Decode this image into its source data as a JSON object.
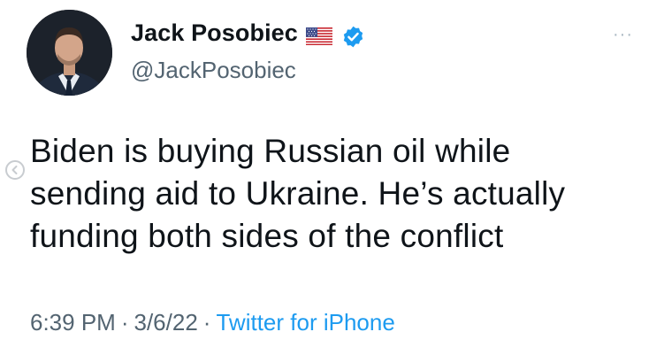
{
  "author": {
    "name": "Jack Posobiec",
    "handle": "@JackPosobiec",
    "flag_icon": "us-flag-icon",
    "verified_icon": "verified-badge-icon",
    "avatar_icon": "profile-photo"
  },
  "more_label": "···",
  "tweet": {
    "lines": [
      "Biden is buying Russian oil while",
      "sending aid to Ukraine. He’s actually",
      "funding both sides of the conflict"
    ]
  },
  "meta": {
    "time": "6:39 PM",
    "separator": "·",
    "date": "3/6/22",
    "source": "Twitter for iPhone"
  },
  "colors": {
    "text": "#0f1419",
    "secondary": "#536471",
    "link": "#1d9bf0",
    "verified": "#1d9bf0"
  }
}
